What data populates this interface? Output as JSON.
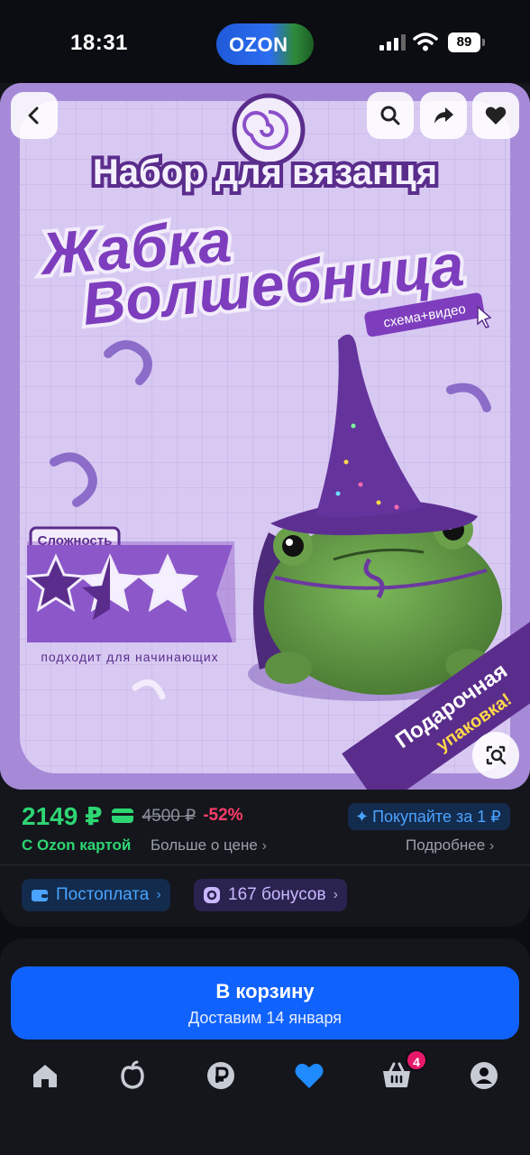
{
  "status_bar": {
    "time": "18:31",
    "battery": "89",
    "island_logo": "OZON"
  },
  "product_image": {
    "kit_title": "Набор для вязанця",
    "product_name_line1": "Жабка",
    "product_name_line2": "Волшебница",
    "tag": "схема+видео",
    "difficulty_label": "Сложность",
    "difficulty_rating": 1.5,
    "difficulty_max": 3,
    "suitable_note": "подходит для начинающих",
    "gift_line1": "Подарочная",
    "gift_line2": "упаковка!",
    "colors": {
      "background": "#a68ad8",
      "accent": "#5a2d8c",
      "frog": "#6aa04a"
    }
  },
  "gallery_buttons": {
    "back": "chevron-left-icon",
    "search": "search-icon",
    "share": "share-icon",
    "favorite": "heart-icon",
    "visual_search": "visual-search-icon"
  },
  "price": {
    "current": "2149 ₽",
    "old": "4500 ₽",
    "discount": "-52%",
    "buy_for_one": "Покупайте за 1 ₽",
    "ozon_card": "С Ozon картой",
    "more_about_price": "Больше о цене",
    "details": "Подробнее",
    "colors": {
      "price": "#2ed573",
      "discount": "#ff3d6b",
      "link": "#4aa3ff"
    }
  },
  "pills": {
    "postpay": "Постоплата",
    "bonuses": "167 бонусов"
  },
  "cart_button": {
    "title": "В корзину",
    "subtitle": "Доставим 14 января",
    "color": "#1062fd"
  },
  "tab_bar": {
    "items": [
      "home-icon",
      "fresh-icon",
      "finance-icon",
      "favorites-icon",
      "cart-icon",
      "profile-icon"
    ],
    "active": "favorites-icon",
    "cart_badge": "4"
  }
}
